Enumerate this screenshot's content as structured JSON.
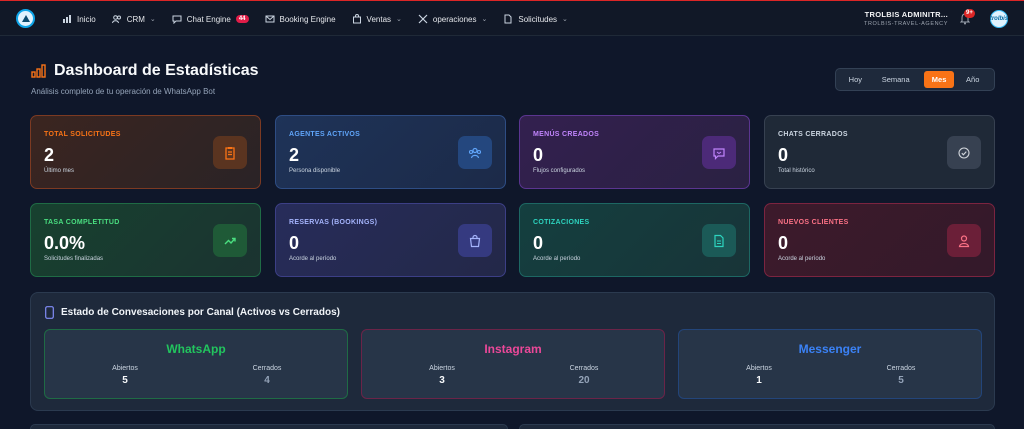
{
  "nav": {
    "items": [
      {
        "label": "Inicio",
        "icon": "home-icon"
      },
      {
        "label": "CRM",
        "icon": "users-icon"
      },
      {
        "label": "Chat Engine",
        "icon": "chat-icon",
        "badge": "44"
      },
      {
        "label": "Booking Engine",
        "icon": "mail-icon"
      },
      {
        "label": "Ventas",
        "icon": "bag-icon"
      },
      {
        "label": "operaciones",
        "icon": "tools-icon"
      },
      {
        "label": "Solicitudes",
        "icon": "document-icon"
      }
    ]
  },
  "user": {
    "name": "TROLBIS ADMINITR...",
    "agency": "TROLBIS-TRAVEL-AGENCY",
    "notifications": "9+",
    "avatar_text": "trolbis"
  },
  "page": {
    "title": "Dashboard de Estadísticas",
    "subtitle": "Análisis completo de tu operación de WhatsApp Bot"
  },
  "range": {
    "options": [
      "Hoy",
      "Semana",
      "Mes",
      "Año"
    ],
    "selected": "Mes"
  },
  "cards": [
    {
      "label": "TOTAL SOLICITUDES",
      "value": "2",
      "desc": "Último mes",
      "accent": "#f97316"
    },
    {
      "label": "AGENTES ACTIVOS",
      "value": "2",
      "desc": "Persona disponible",
      "accent": "#3b82f6"
    },
    {
      "label": "MENÚS CREADOS",
      "value": "0",
      "desc": "Flujos configurados",
      "accent": "#a855f7"
    },
    {
      "label": "CHATS CERRADOS",
      "value": "0",
      "desc": "Total histórico",
      "accent": "#94a3b8"
    },
    {
      "label": "TASA COMPLETITUD",
      "value": "0.0%",
      "desc": "Solicitudes finalizadas",
      "accent": "#22c55e"
    },
    {
      "label": "RESERVAS (BOOKINGS)",
      "value": "0",
      "desc": "Acorde al período",
      "accent": "#818cf8"
    },
    {
      "label": "COTIZACIONES",
      "value": "0",
      "desc": "Acorde al período",
      "accent": "#14b8a6"
    },
    {
      "label": "NUEVOS CLIENTES",
      "value": "0",
      "desc": "Acorde al período",
      "accent": "#f43f5e"
    }
  ],
  "channels": {
    "title": "Estado de Convesaciones por Canal (Activos vs Cerrados)",
    "items": [
      {
        "name": "WhatsApp",
        "color": "#22c55e",
        "open_label": "Abiertos",
        "open": "5",
        "closed_label": "Cerrados",
        "closed": "4"
      },
      {
        "name": "Instagram",
        "color": "#ec4899",
        "open_label": "Abiertos",
        "open": "3",
        "closed_label": "Cerrados",
        "closed": "20"
      },
      {
        "name": "Messenger",
        "color": "#3b82f6",
        "open_label": "Abiertos",
        "open": "1",
        "closed_label": "Cerrados",
        "closed": "5"
      }
    ]
  }
}
